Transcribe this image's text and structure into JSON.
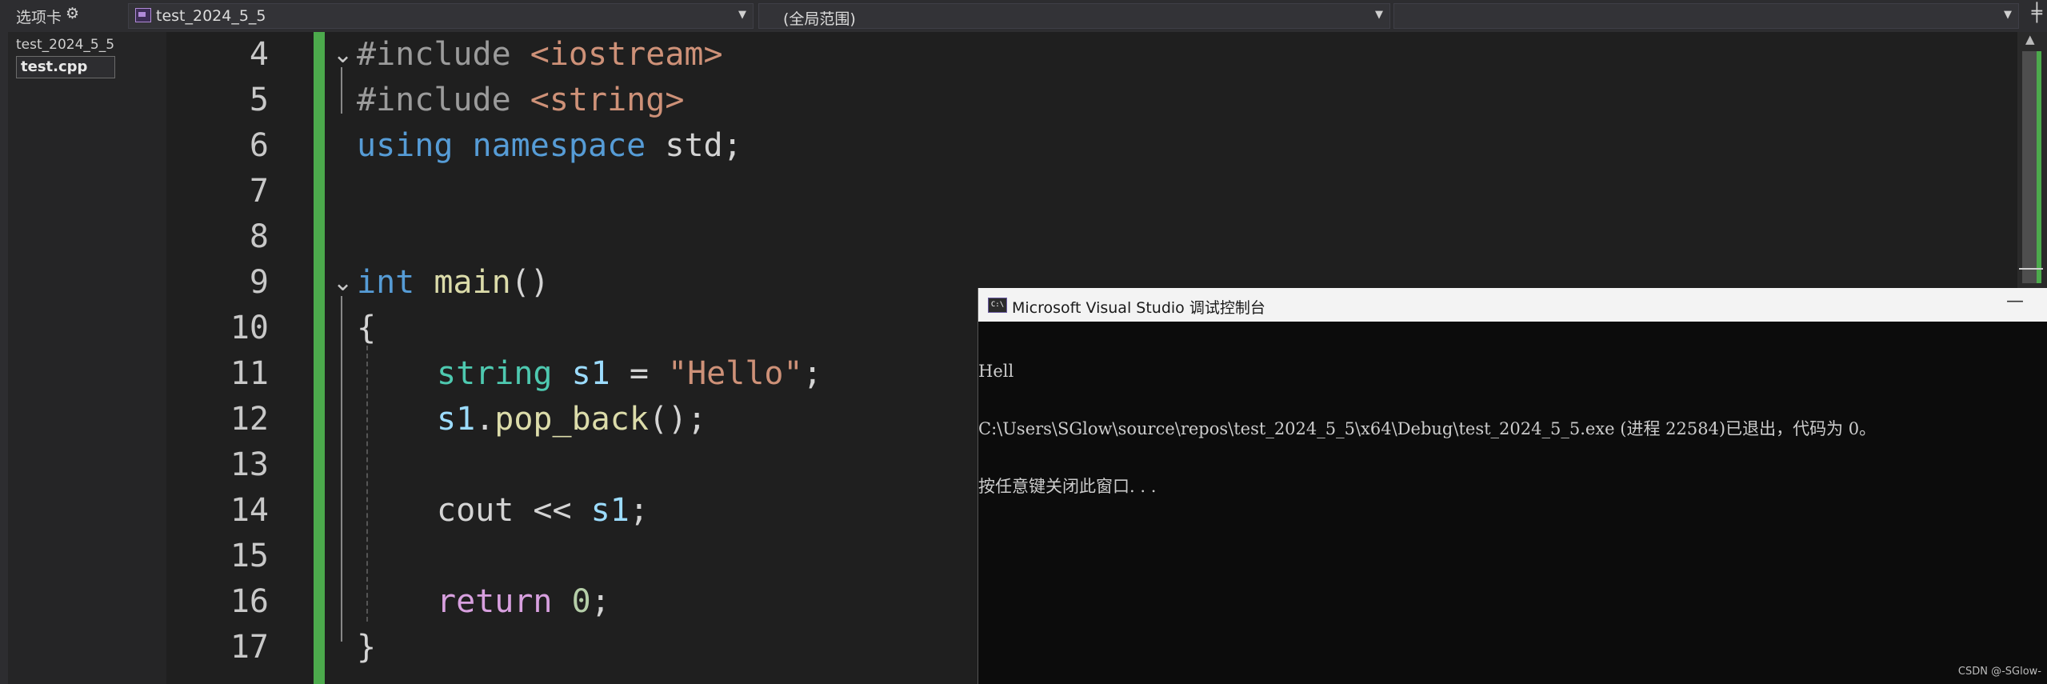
{
  "toolbar": {
    "tabs_label": "选项卡",
    "project_dropdown": "test_2024_5_5",
    "scope_dropdown": "(全局范围)",
    "member_dropdown": ""
  },
  "sidebar": {
    "project": "test_2024_5_5",
    "active_file": "test.cpp"
  },
  "editor": {
    "line_numbers": [
      "4",
      "5",
      "6",
      "7",
      "8",
      "9",
      "10",
      "11",
      "12",
      "13",
      "14",
      "15",
      "16",
      "17"
    ],
    "lines": {
      "l4": {
        "kw": "#include",
        "arg": "<iostream>"
      },
      "l5": {
        "kw": "#include",
        "arg": "<string>"
      },
      "l6": {
        "using": "using",
        "namespace": "namespace",
        "rest": "std;"
      },
      "l9": {
        "type": "int",
        "fn": "main",
        "rest": "()"
      },
      "l10": {
        "text": "{"
      },
      "l11": {
        "type": "string",
        "var": "s1",
        "op": " = ",
        "str": "\"Hello\"",
        "end": ";"
      },
      "l12": {
        "var": "s1",
        "dot": ".",
        "fn": "pop_back",
        "rest": "();"
      },
      "l14": {
        "cout": "cout",
        "op": " << ",
        "var": "s1",
        "end": ";"
      },
      "l16": {
        "ret": "return",
        "num": "0",
        "end": ";"
      },
      "l17": {
        "text": "}"
      }
    }
  },
  "console": {
    "title": "Microsoft Visual Studio 调试控制台",
    "icon_label": "C:\\",
    "output": [
      "Hell",
      "C:\\Users\\SGlow\\source\\repos\\test_2024_5_5\\x64\\Debug\\test_2024_5_5.exe (进程 22584)已退出，代码为 0。",
      "按任意键关闭此窗口. . ."
    ]
  },
  "watermark": "CSDN @-SGlow-",
  "colors": {
    "change_bar": "#4caa4c",
    "keyword": "#569cd6",
    "string": "#ce9178",
    "type": "#4ec9b0",
    "function": "#dcdcaa",
    "variable": "#9cdcfe",
    "control": "#d8a0df"
  }
}
